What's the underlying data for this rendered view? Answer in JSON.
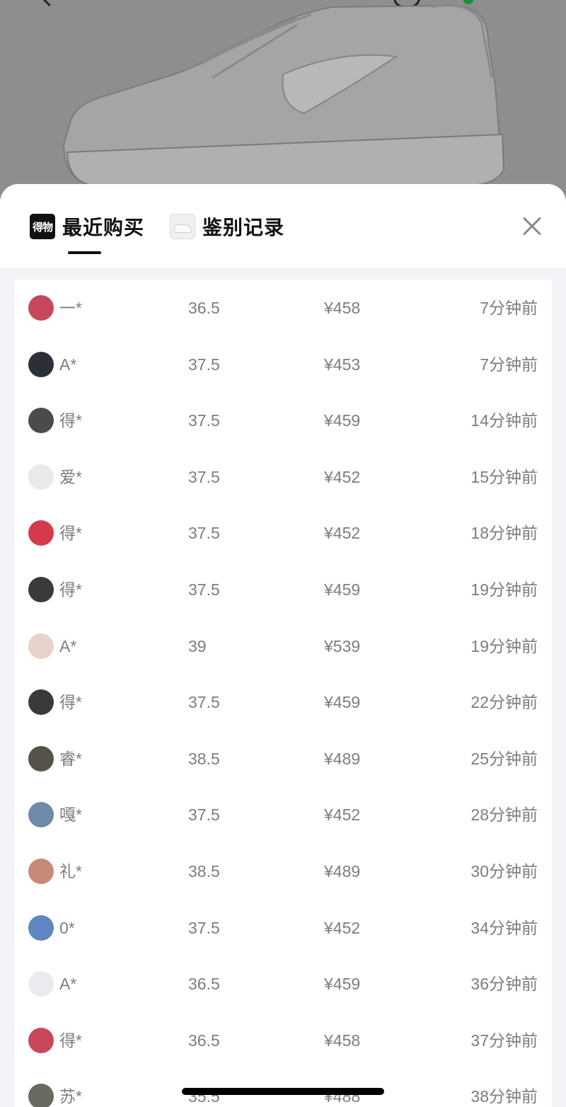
{
  "header": {
    "tabs": [
      {
        "logo_text": "得物",
        "label": "最近购买",
        "active": true
      },
      {
        "label": "鉴别记录",
        "active": false
      }
    ],
    "close_icon": "close-icon"
  },
  "purchases": [
    {
      "name": "一*",
      "size": "36.5",
      "price": "¥458",
      "time": "7分钟前",
      "avatar_color": "#c9475a"
    },
    {
      "name": "A*",
      "size": "37.5",
      "price": "¥453",
      "time": "7分钟前",
      "avatar_color": "#2b2f38"
    },
    {
      "name": "得*",
      "size": "37.5",
      "price": "¥459",
      "time": "14分钟前",
      "avatar_color": "#4b4b4b"
    },
    {
      "name": "爱*",
      "size": "37.5",
      "price": "¥452",
      "time": "15分钟前",
      "avatar_color": "#e9e9e9"
    },
    {
      "name": "得*",
      "size": "37.5",
      "price": "¥452",
      "time": "18分钟前",
      "avatar_color": "#d43a4a"
    },
    {
      "name": "得*",
      "size": "37.5",
      "price": "¥459",
      "time": "19分钟前",
      "avatar_color": "#3a3a3a"
    },
    {
      "name": "A*",
      "size": "39",
      "price": "¥539",
      "time": "19分钟前",
      "avatar_color": "#e8d3c8"
    },
    {
      "name": "得*",
      "size": "37.5",
      "price": "¥459",
      "time": "22分钟前",
      "avatar_color": "#3a3a3a"
    },
    {
      "name": "睿*",
      "size": "38.5",
      "price": "¥489",
      "time": "25分钟前",
      "avatar_color": "#56524a"
    },
    {
      "name": "嘎*",
      "size": "37.5",
      "price": "¥452",
      "time": "28分钟前",
      "avatar_color": "#6f8aa8"
    },
    {
      "name": "礼*",
      "size": "38.5",
      "price": "¥489",
      "time": "30分钟前",
      "avatar_color": "#c88a78"
    },
    {
      "name": "0*",
      "size": "37.5",
      "price": "¥452",
      "time": "34分钟前",
      "avatar_color": "#5f86c2"
    },
    {
      "name": "A*",
      "size": "36.5",
      "price": "¥459",
      "time": "36分钟前",
      "avatar_color": "#eceaf0"
    },
    {
      "name": "得*",
      "size": "36.5",
      "price": "¥458",
      "time": "37分钟前",
      "avatar_color": "#c9475a"
    },
    {
      "name": "苏*",
      "size": "35.5",
      "price": "¥488",
      "time": "38分钟前",
      "avatar_color": "#6a6a62"
    }
  ]
}
